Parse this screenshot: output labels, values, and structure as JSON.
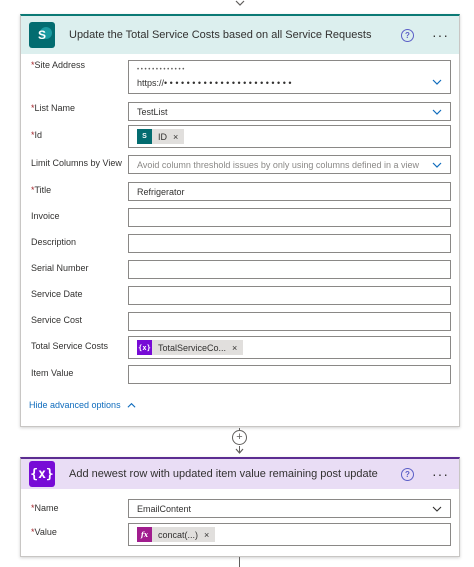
{
  "card1": {
    "title": "Update the Total Service Costs based on all Service Requests",
    "icon": "sharepoint-icon",
    "icon_letter": "S",
    "fields": {
      "site_address": {
        "label": "Site Address",
        "required": true,
        "line1": "• • • • •    • • • • • • • •",
        "line2": "https://• • • • • • • • • • • • • • • • • • • • • • •"
      },
      "list_name": {
        "label": "List Name",
        "required": true,
        "value": "TestList"
      },
      "id": {
        "label": "Id",
        "required": true,
        "token": "ID",
        "token_icon": "S"
      },
      "limit_columns": {
        "label": "Limit Columns by View",
        "placeholder": "Avoid column threshold issues by only using columns defined in a view"
      },
      "title": {
        "label": "Title",
        "required": true,
        "value": "Refrigerator"
      },
      "invoice": {
        "label": "Invoice",
        "value": ""
      },
      "description": {
        "label": "Description",
        "value": ""
      },
      "serial_number": {
        "label": "Serial Number",
        "value": ""
      },
      "service_date": {
        "label": "Service Date",
        "value": ""
      },
      "service_cost": {
        "label": "Service Cost",
        "value": ""
      },
      "total_service_costs": {
        "label": "Total Service Costs",
        "token": "TotalServiceCo...",
        "token_icon": "{x}"
      },
      "item_value": {
        "label": "Item Value",
        "value": ""
      }
    },
    "advanced_link": "Hide advanced options"
  },
  "card2": {
    "title": "Add newest row with updated item value remaining post update",
    "icon": "variable-icon",
    "icon_label": "{x}",
    "fields": {
      "name": {
        "label": "Name",
        "required": true,
        "value": "EmailContent"
      },
      "value": {
        "label": "Value",
        "required": true,
        "token": "concat(...)",
        "token_icon": "fx"
      }
    }
  },
  "required_mark": "*",
  "more_label": "···",
  "help_label": "?",
  "plus_label": "+",
  "token_remove": "×",
  "colors": {
    "sharepoint": "#036c70",
    "variable": "#770bd6",
    "expression": "#a11d8e",
    "link": "#0f6cbd",
    "required": "#a4262c"
  }
}
